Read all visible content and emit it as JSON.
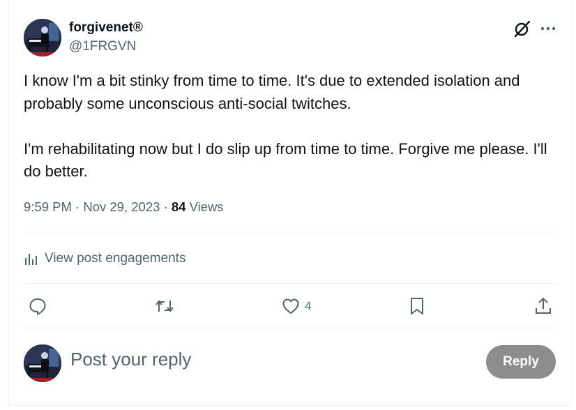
{
  "author": {
    "display_name": "forgivenet®",
    "handle": "@1FRGVN",
    "avatar_icon": "pianist-avatar"
  },
  "header_icons": [
    "grok-icon",
    "more-icon"
  ],
  "post": {
    "paragraphs": [
      "I know I'm a bit stinky from time to time. It's due to extended isolation and probably some unconscious anti-social twitches.",
      "I'm rehabilitating now but I do slip up from time to time. Forgive me please. I'll do better."
    ]
  },
  "meta": {
    "time": "9:59 PM",
    "separator": "·",
    "date": "Nov 29, 2023",
    "views_count": "84",
    "views_label": "Views"
  },
  "engagements_label": "View post engagements",
  "actions": {
    "reply_count": "",
    "repost_count": "",
    "like_count": "4",
    "bookmark_count": "",
    "share_count": ""
  },
  "reply_box": {
    "placeholder": "Post your reply",
    "button_label": "Reply"
  },
  "colors": {
    "text_primary": "#0f1419",
    "text_secondary": "#536471",
    "divider": "#eff3f4",
    "reply_button_disabled": "#8b8d8f"
  }
}
